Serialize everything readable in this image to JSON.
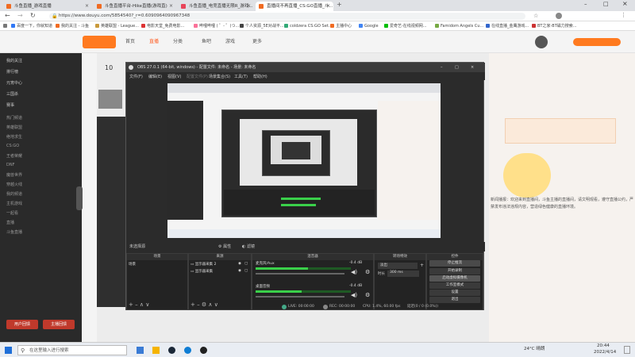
{
  "browser": {
    "tabs": [
      {
        "label": "斗鱼直播_游戏直播",
        "color": "#f06b22",
        "active": false
      },
      {
        "label": "斗鱼直播平台-Hike直播(游戏直)",
        "color": "#f06b22",
        "active": false
      },
      {
        "label": "斗鱼直播_电竞直播无限R_游戏...",
        "color": "#e8455a",
        "active": false
      },
      {
        "label": "直播间不再直播_CS:GO直播_斗...",
        "color": "#f06b22",
        "active": true
      }
    ],
    "url": "https://www.douyu.com/5854540?_r=0.60909640909673​48",
    "bookmarks": [
      {
        "label": "百度一下，你就知道",
        "color": "#3078f6"
      },
      {
        "label": "我的关注 - 斗鱼",
        "color": "#f06b22"
      },
      {
        "label": "英雄联盟 - League...",
        "color": "#c99a3c"
      },
      {
        "label": "电影天堂_免费电影...",
        "color": "#d33"
      },
      {
        "label": "哔哩哔哩 ( ゜- ゜)つ...",
        "color": "#fb7299"
      },
      {
        "label": "个人资源_5E对战平...",
        "color": "#444"
      },
      {
        "label": "coldzera CS:GO Set...",
        "color": "#3a7"
      },
      {
        "label": "主播中心",
        "color": "#f06b22"
      },
      {
        "label": "Google",
        "color": "#4285f4"
      },
      {
        "label": "爱奇艺-在线视频网...",
        "color": "#00be06"
      },
      {
        "label": "Famidom Angels Cu...",
        "color": "#7a4"
      },
      {
        "label": "在线直播_金鹰游戏...",
        "color": "#36c"
      },
      {
        "label": "BT之家-BT磁力搜索...",
        "color": "#c33"
      }
    ]
  },
  "site": {
    "nav": [
      "首页",
      "直播",
      "分类",
      "鱼吧",
      "游戏",
      "更多"
    ],
    "left_menu": [
      "我的关注",
      "排行榜",
      "元宵中心",
      "三国杀",
      "赛事",
      "热门频道",
      "英雄联盟",
      "绝地求生",
      "CS:GO",
      "王者荣耀",
      "DNF",
      "魔兽世界",
      "穿越火线",
      "我的频道",
      "主机游戏",
      "一起看",
      "直播",
      "斗鱼直播"
    ],
    "left_buttons": [
      "用户回馈",
      "主播回馈"
    ],
    "room_number": "10",
    "right_text": "新闻播报：欢迎来到直播间，斗鱼主播的直播间，请文明观看，遵守直播公约，严禁发布违法违规内容，营造绿色健康的直播环境。"
  },
  "obs": {
    "title": "OBS 27.0.1 (64-bit, windows) - 配置文件: 未命名 - 场景: 未命名",
    "menu": [
      "文件(F)",
      "编辑(E)",
      "视图(V)",
      "配置文件(P)",
      "场景集合(S)",
      "工具(T)",
      "帮助(H)"
    ],
    "status_label": "未选择源",
    "props_label": "属性",
    "filters_label": "滤镜",
    "docks": {
      "scenes": {
        "title": "场景",
        "items": [
          "场景"
        ]
      },
      "sources": {
        "title": "来源",
        "items": [
          "显示器采集 2",
          "显示器采集"
        ]
      },
      "mixer": {
        "title": "混音器",
        "channels": [
          {
            "name": "麦克风/Aux",
            "db": "-0.4 dB",
            "level": 0.55
          },
          {
            "name": "桌面音频",
            "db": "-0.4 dB",
            "level": 0.48
          }
        ]
      },
      "transitions": {
        "title": "转场特效",
        "type": "淡出",
        "duration_label": "时长",
        "duration": "300 ms"
      },
      "controls": {
        "title": "控件",
        "buttons": [
          "停止推流",
          "开始录制",
          "启动虚拟摄像机",
          "工作室模式",
          "设置",
          "退出"
        ]
      }
    },
    "statusbar": {
      "live": "LIVE: 00:00:00",
      "rec": "REC: 00:00:00",
      "cpu": "CPU: 1.4%, 60.00 fps",
      "dropped": "延迟(0 / 0 (0.0%))"
    }
  },
  "taskbar": {
    "search_placeholder": "在这里输入进行搜索",
    "weather": "24°C 晴朗",
    "time": "20:44",
    "date": "2022/4/14"
  }
}
